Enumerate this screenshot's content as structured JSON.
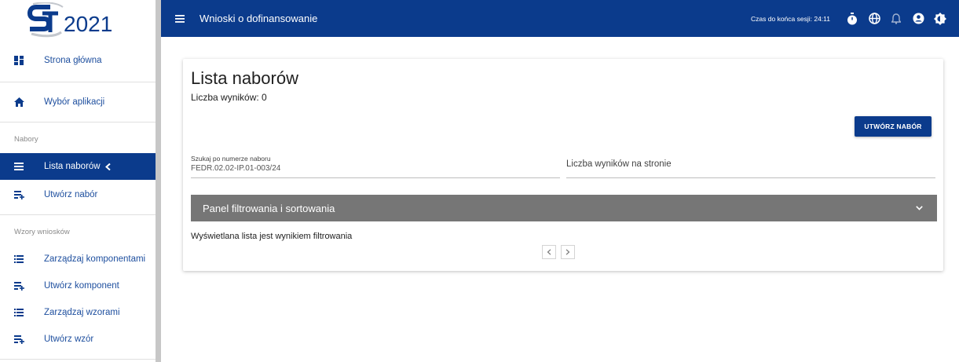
{
  "logo": {
    "text": "2021"
  },
  "sidebar": {
    "items_top": [
      {
        "label": "Strona główna",
        "icon": "dashboard-icon"
      },
      {
        "label": "Wybór aplikacji",
        "icon": "home-icon"
      }
    ],
    "section_nabory": "Nabory",
    "items_nabory": [
      {
        "label": "Lista naborów",
        "icon": "list-icon",
        "active": true
      },
      {
        "label": "Utwórz nabór",
        "icon": "playlist-add-icon"
      }
    ],
    "section_wzory": "Wzory wniosków",
    "items_wzory": [
      {
        "label": "Zarządzaj komponentami",
        "icon": "list-icon"
      },
      {
        "label": "Utwórz komponent",
        "icon": "playlist-add-icon"
      },
      {
        "label": "Zarządzaj wzorami",
        "icon": "list-icon"
      },
      {
        "label": "Utwórz wzór",
        "icon": "playlist-add-icon"
      }
    ]
  },
  "topbar": {
    "title": "Wnioski o dofinansowanie",
    "session": "Czas do końca sesji: 24:11",
    "icons": [
      "timer-icon",
      "globe-icon",
      "bell-icon",
      "account-icon",
      "contrast-icon"
    ]
  },
  "main": {
    "title": "Lista naborów",
    "count": "Liczba wyników: 0",
    "create_button": "UTWÓRZ NABÓR",
    "search_label": "Szukaj po numerze naboru",
    "search_value": "FEDR.02.02-IP.01-003/24",
    "per_page_placeholder": "Liczba wyników na stronie",
    "panel_title": "Panel filtrowania i sortowania",
    "filtered_note": "Wyświetlana lista jest wynikiem filtrowania"
  },
  "colors": {
    "primary": "#0b3b8c",
    "panel": "#767676"
  }
}
